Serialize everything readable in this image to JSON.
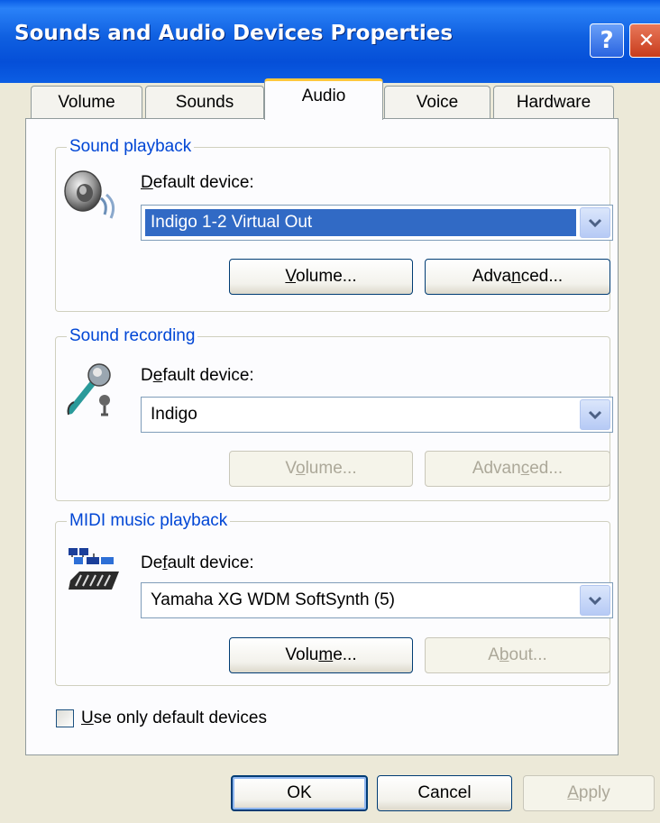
{
  "window": {
    "title": "Sounds and Audio Devices Properties",
    "help_glyph": "?",
    "close_glyph": "✕"
  },
  "tabs": [
    {
      "label": "Volume"
    },
    {
      "label": "Sounds"
    },
    {
      "label": "Audio",
      "active": true
    },
    {
      "label": "Voice"
    },
    {
      "label": "Hardware"
    }
  ],
  "playback": {
    "group_label": "Sound playback",
    "icon": "speaker-icon",
    "default_label_pre": "",
    "default_label_u": "D",
    "default_label_post": "efault device:",
    "device": "Indigo 1-2 Virtual Out",
    "volume_pre": "",
    "volume_u": "V",
    "volume_post": "olume...",
    "advanced_pre": "Adva",
    "advanced_u": "n",
    "advanced_post": "ced..."
  },
  "recording": {
    "group_label": "Sound recording",
    "icon": "microphone-icon",
    "default_label_pre": "D",
    "default_label_u": "e",
    "default_label_post": "fault device:",
    "device": "Indigo",
    "volume_pre": "V",
    "volume_u": "o",
    "volume_post": "lume...",
    "advanced_pre": "Advan",
    "advanced_u": "c",
    "advanced_post": "ed..."
  },
  "midi": {
    "group_label": "MIDI music playback",
    "icon": "midi-keyboard-icon",
    "default_label_pre": "De",
    "default_label_u": "f",
    "default_label_post": "ault device:",
    "device": "Yamaha XG WDM SoftSynth (5)",
    "volume_pre": "Volu",
    "volume_u": "m",
    "volume_post": "e...",
    "about_pre": "A",
    "about_u": "b",
    "about_post": "out..."
  },
  "use_default": {
    "pre": "",
    "u": "U",
    "post": "se only default devices",
    "checked": false
  },
  "footer": {
    "ok": "OK",
    "cancel": "Cancel",
    "apply_u": "A",
    "apply_post": "pply"
  },
  "colors": {
    "titlebar": "#0a5de6",
    "group_label": "#0046d5",
    "selection": "#316ac5",
    "active_tab_accent": "#ffc83c"
  }
}
